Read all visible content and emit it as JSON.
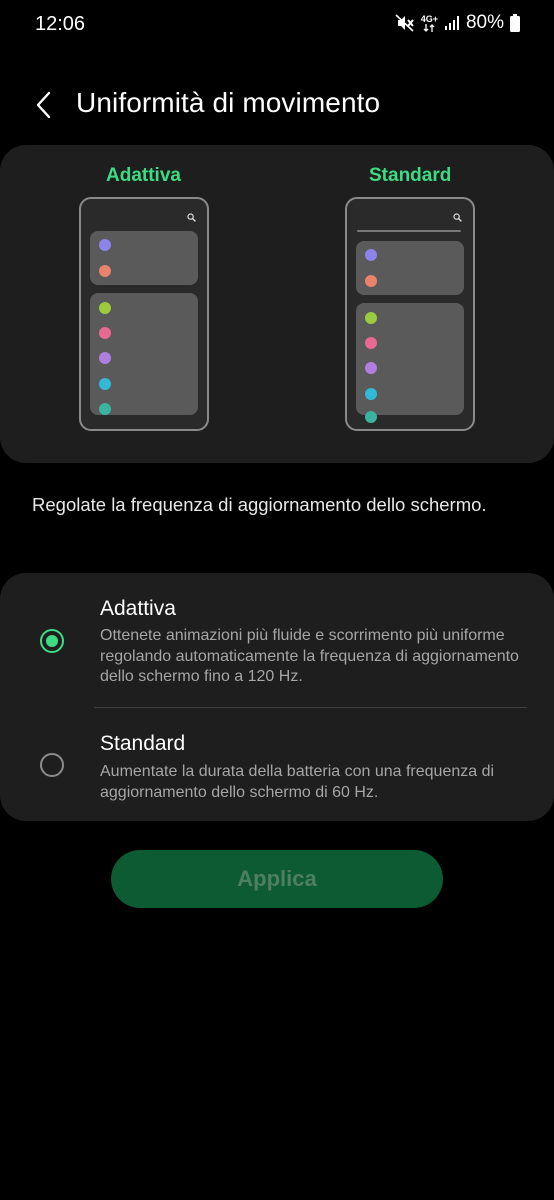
{
  "status": {
    "time": "12:06",
    "network": "4G+",
    "battery": "80%",
    "icons": [
      "mute-vibrate-icon",
      "network-4g-icon",
      "signal-icon",
      "battery-icon"
    ]
  },
  "header": {
    "title": "Uniformità di movimento",
    "back_icon": "chevron-left-icon"
  },
  "preview": {
    "adaptive_label": "Adattiva",
    "standard_label": "Standard",
    "search_icon": "search-icon",
    "dot_colors": [
      "#8c84e8",
      "#e8836c",
      "#9ccb3e",
      "#e86a92",
      "#b07ee0",
      "#33b9d6",
      "#3ab3a0"
    ]
  },
  "description": "Regolate la frequenza di aggiornamento dello schermo.",
  "options": [
    {
      "title": "Adattiva",
      "desc": "Ottenete animazioni più fluide e scorrimento più uniforme regolando automaticamente la frequenza di aggiornamento dello schermo fino a 120 Hz.",
      "selected": true
    },
    {
      "title": "Standard",
      "desc": "Aumentate la durata della batteria con una frequenza di aggiornamento dello schermo di 60 Hz.",
      "selected": false
    }
  ],
  "apply_label": "Applica",
  "colors": {
    "accent": "#3ddc84",
    "card": "#1e1e1e",
    "button": "#0d5b33"
  }
}
